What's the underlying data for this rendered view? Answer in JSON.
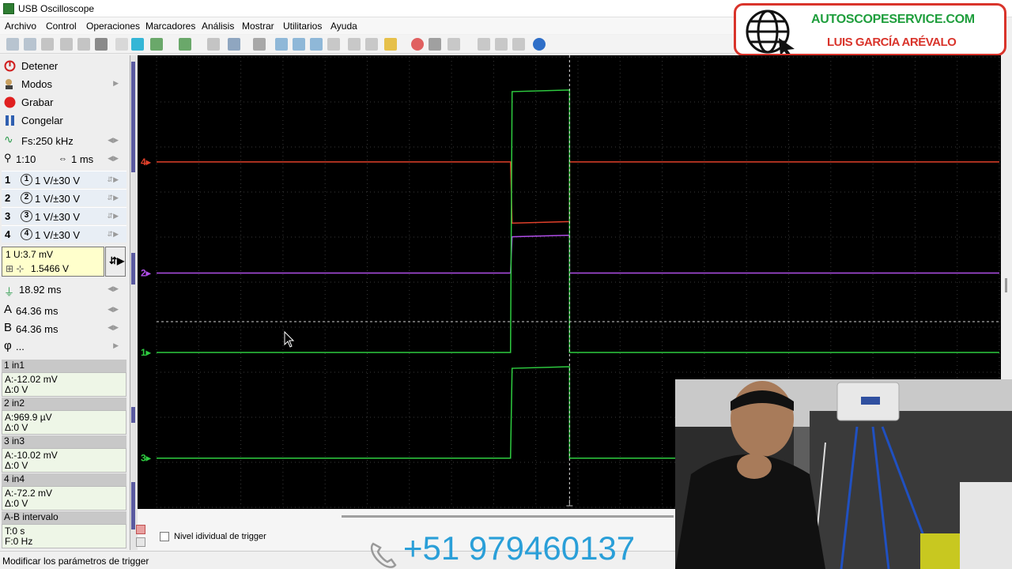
{
  "window": {
    "title": "USB Oscilloscope"
  },
  "menu": [
    "Archivo",
    "Control",
    "Operaciones",
    "Marcadores",
    "Análisis",
    "Mostrar",
    "Utilitarios",
    "Ayuda"
  ],
  "logo": {
    "line1": "AUTOSCOPESERVICE.COM",
    "line2": "LUIS GARCÍA ARÉVALO"
  },
  "panel": {
    "stop": "Detener",
    "modes": "Modos",
    "record": "Grabar",
    "freeze": "Congelar",
    "fs": "Fs:250 kHz",
    "zoom": "1:10",
    "timebase": "1 ms",
    "channels": [
      {
        "num": "1",
        "circle": "1",
        "value": "1 V/±30 V"
      },
      {
        "num": "2",
        "circle": "2",
        "value": "1 V/±30 V"
      },
      {
        "num": "3",
        "circle": "3",
        "value": "1 V/±30 V"
      },
      {
        "num": "4",
        "circle": "4",
        "value": "1 V/±30 V"
      }
    ],
    "trigger": {
      "line1": "1  U:3.7 mV",
      "line2": "1.5466 V"
    },
    "period": "18.92 ms",
    "marker_a": "64.36 ms",
    "marker_b": "64.36 ms",
    "phi": "...",
    "measurements": [
      {
        "head": "1 in1",
        "a": "A:-12.02 mV",
        "d": "Δ:0 V"
      },
      {
        "head": "2 in2",
        "a": "A:969.9 µV",
        "d": "Δ:0 V"
      },
      {
        "head": "3 in3",
        "a": "A:-10.02 mV",
        "d": "Δ:0 V"
      },
      {
        "head": "4 in4",
        "a": "A:-72.2 mV",
        "d": "Δ:0 V"
      }
    ],
    "interval": {
      "head": "A-B intervalo",
      "t": "T:0 s",
      "f": "F:0 Hz"
    }
  },
  "trigger_checkbox": "Nivel idividual de trigger",
  "status": "Modificar los parámetros de trigger",
  "phone": "+51 979460137",
  "colors": {
    "ch1": "#2ecc40",
    "ch2": "#b04ee8",
    "ch3": "#2ecc40",
    "ch4": "#e0402a",
    "accent": "#d9342b"
  },
  "scope": {
    "channels": [
      {
        "label": "4",
        "color": "#e0402a",
        "level": 0.235,
        "pulse": 0.37
      },
      {
        "label": "2",
        "color": "#b04ee8",
        "level": 0.48,
        "pulse": 0.4
      },
      {
        "label": "1",
        "color": "#2ecc40",
        "level": 0.655,
        "pulse": 0.08
      },
      {
        "label": "3",
        "color": "#2ecc40",
        "level": 0.888,
        "pulse": 0.69
      }
    ],
    "pulse_start": 0.42,
    "pulse_end": 0.49
  }
}
